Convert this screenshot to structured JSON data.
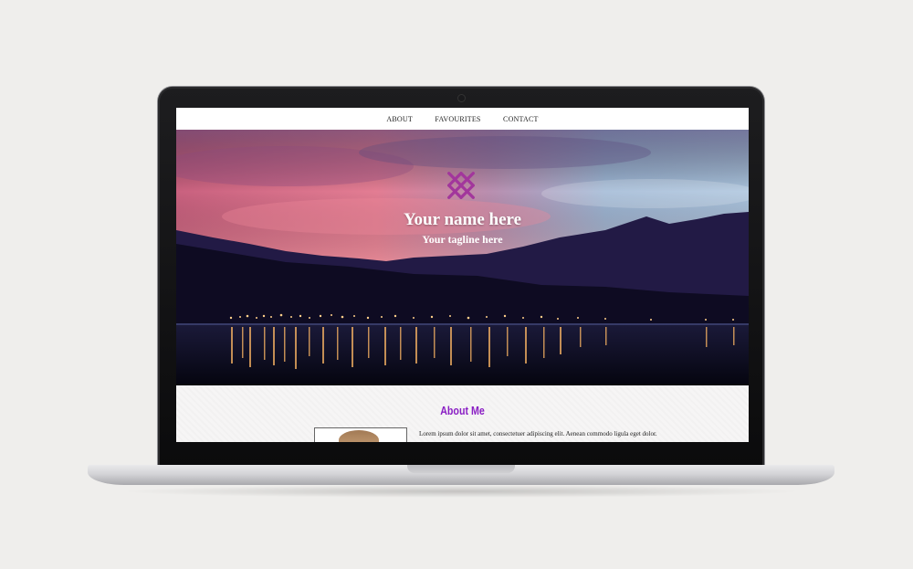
{
  "nav": {
    "items": [
      {
        "label": "ABOUT"
      },
      {
        "label": "FAVOURITES"
      },
      {
        "label": "CONTACT"
      }
    ]
  },
  "hero": {
    "name": "Your name here",
    "tagline": "Your tagline here",
    "logo_icon": "crosshatch-logo-icon"
  },
  "about": {
    "title": "About Me",
    "text": "Lorem ipsum dolor sit amet, consectetuer adipiscing elit. Aenean commodo ligula eget dolor.",
    "photo_icon": "portrait-photo"
  },
  "colors": {
    "accent": "#8a1fc4",
    "logo": "#a2369c",
    "background": "#efeeec"
  }
}
